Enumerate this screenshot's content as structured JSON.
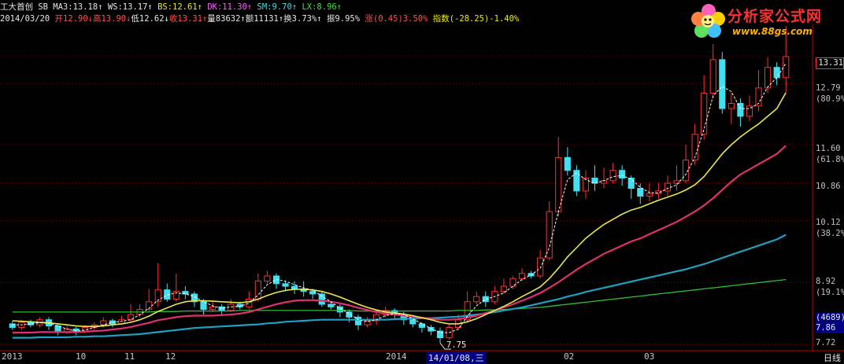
{
  "header": {
    "name": "工大首创",
    "ma_label": "SB MA3:13.18",
    "ws": "WS:13.17",
    "bs": "BS:12.61",
    "dk": "DK:11.30",
    "sm": "SM:9.70",
    "lx": "LX:8.96",
    "date": "2014/03/20",
    "open": "开12.90",
    "high": "高13.90",
    "low": "低12.62",
    "close": "收13.31",
    "vol": "量83632",
    "amount": "额11131",
    "turnover": "换3.73%",
    "amplitude": "振9.95%",
    "change": "涨(0.45)3.50%",
    "index": "指数(-28.25)-1.40%"
  },
  "logo": {
    "title": "分析家公式网",
    "url": "www.88gs.com"
  },
  "y_axis": [
    {
      "value": "12.79",
      "pct": "(80.9%)"
    },
    {
      "value": "11.60",
      "pct": "(61.8%)"
    },
    {
      "value": "10.86",
      "pct": ""
    },
    {
      "value": "10.12",
      "pct": "(38.2%)"
    },
    {
      "value": "8.92",
      "pct": "(19.1%)"
    },
    {
      "value": "7.72",
      "pct": ""
    }
  ],
  "current_price": "13.31",
  "volume_box": {
    "count": "(4689)",
    "value": "7.86"
  },
  "low_marker": "7.75",
  "x_axis": [
    {
      "label": "2013"
    },
    {
      "label": "10"
    },
    {
      "label": "11"
    },
    {
      "label": "12"
    },
    {
      "label": "2014"
    },
    {
      "label": "02"
    },
    {
      "label": "03"
    }
  ],
  "cursor_date": "14/01/08,三",
  "period": "日线",
  "chart_data": {
    "type": "candlestick",
    "y_range": [
      7.6,
      13.95
    ],
    "series_colors": {
      "up": "#ff3030",
      "down": "#40e0f0",
      "ma_white": "#ffffff",
      "ma_yellow": "#e8e850",
      "ma_pink": "#e03070",
      "ma_cyan": "#20a0c0",
      "ma_green": "#30c030"
    },
    "candles": [
      [
        8.12,
        8.05,
        8.18,
        8.0
      ],
      [
        8.05,
        8.15,
        8.2,
        8.0
      ],
      [
        8.15,
        8.1,
        8.2,
        8.05
      ],
      [
        8.1,
        8.2,
        8.25,
        8.05
      ],
      [
        8.2,
        8.08,
        8.25,
        8.0
      ],
      [
        8.08,
        7.95,
        8.12,
        7.9
      ],
      [
        7.95,
        8.02,
        8.08,
        7.92
      ],
      [
        8.02,
        7.98,
        8.06,
        7.9
      ],
      [
        7.98,
        8.05,
        8.1,
        7.95
      ],
      [
        8.05,
        8.1,
        8.15,
        8.0
      ],
      [
        8.1,
        8.18,
        8.25,
        8.05
      ],
      [
        8.18,
        8.12,
        8.22,
        8.05
      ],
      [
        8.12,
        8.2,
        8.28,
        8.1
      ],
      [
        8.2,
        8.3,
        8.5,
        8.15
      ],
      [
        8.3,
        8.4,
        8.5,
        8.25
      ],
      [
        8.4,
        8.55,
        8.8,
        8.35
      ],
      [
        8.55,
        8.78,
        9.3,
        8.45
      ],
      [
        8.78,
        8.6,
        8.9,
        8.55
      ],
      [
        8.6,
        8.75,
        9.1,
        8.55
      ],
      [
        8.75,
        8.7,
        8.85,
        8.6
      ],
      [
        8.7,
        8.55,
        8.75,
        8.45
      ],
      [
        8.55,
        8.4,
        8.6,
        8.3
      ],
      [
        8.4,
        8.45,
        8.55,
        8.35
      ],
      [
        8.45,
        8.38,
        8.5,
        8.3
      ],
      [
        8.38,
        8.5,
        8.6,
        8.35
      ],
      [
        8.5,
        8.45,
        8.55,
        8.4
      ],
      [
        8.45,
        8.6,
        8.75,
        8.4
      ],
      [
        8.6,
        8.95,
        9.1,
        8.55
      ],
      [
        8.95,
        9.05,
        9.15,
        8.9
      ],
      [
        9.05,
        8.9,
        9.1,
        8.8
      ],
      [
        8.9,
        8.85,
        8.95,
        8.75
      ],
      [
        8.85,
        8.8,
        8.95,
        8.7
      ],
      [
        8.8,
        8.75,
        8.95,
        8.65
      ],
      [
        8.75,
        8.7,
        8.8,
        8.6
      ],
      [
        8.7,
        8.5,
        8.75,
        8.45
      ],
      [
        8.5,
        8.45,
        8.55,
        8.4
      ],
      [
        8.45,
        8.35,
        8.5,
        8.25
      ],
      [
        8.35,
        8.25,
        8.4,
        8.15
      ],
      [
        8.25,
        8.1,
        8.3,
        8.0
      ],
      [
        8.1,
        8.18,
        8.25,
        8.05
      ],
      [
        8.18,
        8.3,
        8.35,
        8.1
      ],
      [
        8.3,
        8.38,
        8.45,
        8.25
      ],
      [
        8.38,
        8.3,
        8.42,
        8.22
      ],
      [
        8.3,
        8.2,
        8.35,
        8.1
      ],
      [
        8.2,
        8.12,
        8.25,
        8.05
      ],
      [
        8.12,
        8.05,
        8.15,
        7.95
      ],
      [
        8.05,
        7.98,
        8.1,
        7.9
      ],
      [
        7.98,
        7.85,
        8.05,
        7.75
      ],
      [
        7.85,
        8.05,
        8.1,
        7.82
      ],
      [
        8.05,
        8.2,
        8.3,
        8.0
      ],
      [
        8.2,
        8.55,
        8.75,
        8.15
      ],
      [
        8.55,
        8.65,
        8.75,
        8.5
      ],
      [
        8.65,
        8.55,
        8.75,
        8.45
      ],
      [
        8.55,
        8.75,
        8.85,
        8.5
      ],
      [
        8.75,
        8.85,
        9.0,
        8.7
      ],
      [
        8.85,
        9.0,
        9.05,
        8.8
      ],
      [
        9.0,
        9.1,
        9.2,
        8.95
      ],
      [
        9.1,
        9.05,
        9.15,
        9.0
      ],
      [
        9.05,
        9.4,
        9.55,
        9.0
      ],
      [
        9.4,
        10.3,
        10.5,
        9.35
      ],
      [
        10.3,
        11.35,
        11.75,
        10.2
      ],
      [
        11.35,
        11.1,
        11.55,
        11.0
      ],
      [
        11.1,
        10.7,
        11.2,
        10.6
      ],
      [
        10.7,
        10.95,
        11.1,
        10.55
      ],
      [
        10.95,
        10.85,
        11.2,
        10.7
      ],
      [
        10.85,
        10.9,
        11.15,
        10.75
      ],
      [
        10.9,
        11.1,
        11.25,
        10.85
      ],
      [
        11.1,
        10.95,
        11.2,
        10.8
      ],
      [
        10.95,
        10.75,
        11.0,
        10.55
      ],
      [
        10.75,
        10.6,
        10.85,
        10.45
      ],
      [
        10.6,
        10.65,
        10.85,
        10.5
      ],
      [
        10.65,
        10.7,
        10.85,
        10.55
      ],
      [
        10.7,
        10.85,
        11.0,
        10.6
      ],
      [
        10.85,
        10.9,
        11.2,
        10.7
      ],
      [
        10.9,
        11.3,
        11.6,
        10.85
      ],
      [
        11.3,
        11.8,
        12.0,
        11.2
      ],
      [
        11.8,
        12.6,
        12.95,
        11.7
      ],
      [
        12.6,
        13.25,
        13.55,
        12.5
      ],
      [
        13.25,
        12.3,
        13.4,
        12.2
      ],
      [
        12.3,
        12.4,
        12.6,
        12.0
      ],
      [
        12.4,
        12.15,
        12.5,
        11.95
      ],
      [
        12.15,
        12.35,
        12.55,
        12.05
      ],
      [
        12.35,
        12.7,
        13.05,
        12.25
      ],
      [
        12.7,
        13.1,
        13.3,
        12.6
      ],
      [
        13.1,
        12.9,
        13.2,
        12.75
      ],
      [
        12.9,
        13.31,
        13.9,
        12.62
      ]
    ],
    "ma_white": [
      8.1,
      8.1,
      8.12,
      8.14,
      8.13,
      8.08,
      8.02,
      7.98,
      8.0,
      8.05,
      8.1,
      8.15,
      8.17,
      8.2,
      8.3,
      8.42,
      8.58,
      8.68,
      8.72,
      8.7,
      8.65,
      8.55,
      8.47,
      8.42,
      8.45,
      8.46,
      8.52,
      8.68,
      8.88,
      8.98,
      8.95,
      8.88,
      8.82,
      8.77,
      8.66,
      8.55,
      8.42,
      8.32,
      8.2,
      8.16,
      8.2,
      8.28,
      8.32,
      8.3,
      8.22,
      8.12,
      8.03,
      7.95,
      7.95,
      8.02,
      8.27,
      8.47,
      8.6,
      8.65,
      8.72,
      8.85,
      8.98,
      9.07,
      9.2,
      9.6,
      10.3,
      10.92,
      11.05,
      10.92,
      10.85,
      10.9,
      10.98,
      11.0,
      10.93,
      10.77,
      10.67,
      10.66,
      10.75,
      10.82,
      11.02,
      11.35,
      11.9,
      12.55,
      12.73,
      12.63,
      12.3,
      12.3,
      12.4,
      12.72,
      12.9,
      13.18
    ],
    "ma_yellow": [
      8.18,
      8.17,
      8.16,
      8.15,
      8.14,
      8.12,
      8.1,
      8.08,
      8.07,
      8.07,
      8.08,
      8.1,
      8.12,
      8.15,
      8.2,
      8.27,
      8.36,
      8.43,
      8.5,
      8.55,
      8.57,
      8.57,
      8.56,
      8.55,
      8.54,
      8.53,
      8.55,
      8.6,
      8.67,
      8.73,
      8.77,
      8.79,
      8.79,
      8.78,
      8.75,
      8.7,
      8.64,
      8.57,
      8.5,
      8.44,
      8.39,
      8.35,
      8.33,
      8.31,
      8.28,
      8.24,
      8.2,
      8.15,
      8.12,
      8.12,
      8.16,
      8.22,
      8.3,
      8.38,
      8.46,
      8.55,
      8.65,
      8.74,
      8.84,
      9.0,
      9.2,
      9.42,
      9.6,
      9.78,
      9.92,
      10.05,
      10.15,
      10.25,
      10.33,
      10.38,
      10.45,
      10.52,
      10.58,
      10.64,
      10.72,
      10.82,
      10.98,
      11.2,
      11.42,
      11.6,
      11.75,
      11.88,
      12.0,
      12.15,
      12.3,
      12.61
    ],
    "ma_pink": [
      7.95,
      7.95,
      7.95,
      7.96,
      7.96,
      7.96,
      7.96,
      7.96,
      7.97,
      7.98,
      7.99,
      8.01,
      8.03,
      8.06,
      8.1,
      8.14,
      8.19,
      8.22,
      8.25,
      8.27,
      8.28,
      8.28,
      8.28,
      8.29,
      8.3,
      8.32,
      8.35,
      8.4,
      8.45,
      8.5,
      8.54,
      8.57,
      8.58,
      8.58,
      8.57,
      8.55,
      8.52,
      8.48,
      8.43,
      8.39,
      8.35,
      8.32,
      8.3,
      8.28,
      8.26,
      8.24,
      8.22,
      8.2,
      8.2,
      8.21,
      8.24,
      8.28,
      8.33,
      8.38,
      8.44,
      8.5,
      8.57,
      8.64,
      8.72,
      8.82,
      8.93,
      9.05,
      9.17,
      9.28,
      9.38,
      9.48,
      9.56,
      9.64,
      9.72,
      9.78,
      9.86,
      9.94,
      10.02,
      10.1,
      10.2,
      10.3,
      10.42,
      10.56,
      10.72,
      10.88,
      11.02,
      11.12,
      11.22,
      11.32,
      11.42,
      11.58
    ],
    "ma_cyan": [
      7.85,
      7.85,
      7.85,
      7.86,
      7.86,
      7.86,
      7.86,
      7.87,
      7.87,
      7.88,
      7.88,
      7.89,
      7.9,
      7.91,
      7.92,
      7.94,
      7.96,
      7.98,
      8.0,
      8.02,
      8.04,
      8.05,
      8.06,
      8.07,
      8.08,
      8.09,
      8.1,
      8.11,
      8.13,
      8.14,
      8.16,
      8.17,
      8.18,
      8.19,
      8.2,
      8.2,
      8.2,
      8.2,
      8.2,
      8.2,
      8.2,
      8.2,
      8.21,
      8.22,
      8.22,
      8.23,
      8.23,
      8.24,
      8.25,
      8.26,
      8.28,
      8.3,
      8.32,
      8.35,
      8.38,
      8.41,
      8.44,
      8.48,
      8.52,
      8.56,
      8.6,
      8.65,
      8.69,
      8.74,
      8.78,
      8.82,
      8.86,
      8.9,
      8.94,
      8.98,
      9.02,
      9.06,
      9.1,
      9.14,
      9.18,
      9.23,
      9.28,
      9.34,
      9.4,
      9.46,
      9.52,
      9.58,
      9.64,
      9.7,
      9.76,
      9.85
    ],
    "ma_green": [
      8.35,
      8.35,
      8.35,
      8.35,
      8.35,
      8.35,
      8.35,
      8.35,
      8.35,
      8.35,
      8.35,
      8.35,
      8.35,
      8.35,
      8.35,
      8.35,
      8.36,
      8.36,
      8.36,
      8.37,
      8.37,
      8.37,
      8.37,
      8.37,
      8.37,
      8.38,
      8.38,
      8.38,
      8.38,
      8.38,
      8.38,
      8.38,
      8.38,
      8.38,
      8.38,
      8.38,
      8.38,
      8.38,
      8.37,
      8.37,
      8.37,
      8.37,
      8.37,
      8.37,
      8.37,
      8.37,
      8.37,
      8.37,
      8.37,
      8.38,
      8.38,
      8.38,
      8.39,
      8.39,
      8.4,
      8.41,
      8.42,
      8.43,
      8.44,
      8.46,
      8.48,
      8.5,
      8.52,
      8.54,
      8.56,
      8.58,
      8.6,
      8.62,
      8.64,
      8.66,
      8.68,
      8.7,
      8.72,
      8.74,
      8.76,
      8.78,
      8.8,
      8.82,
      8.84,
      8.86,
      8.88,
      8.9,
      8.92,
      8.94,
      8.96,
      8.98
    ]
  }
}
